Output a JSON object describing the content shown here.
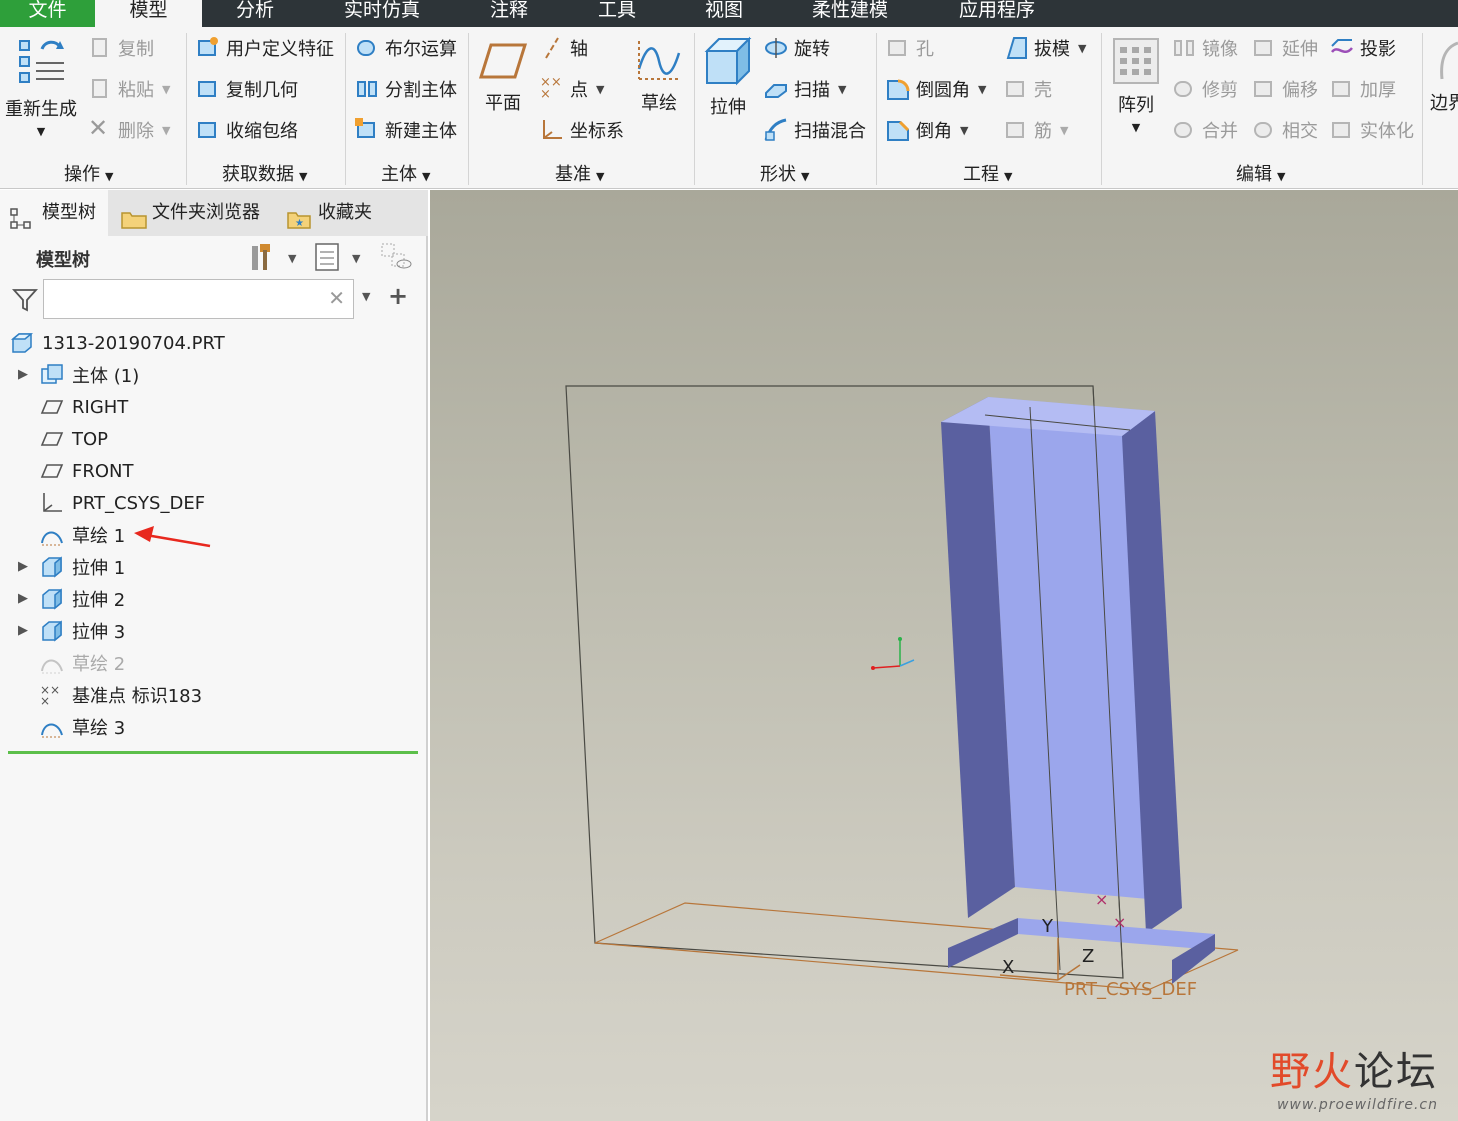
{
  "menu": {
    "tabs": [
      "文件",
      "模型",
      "分析",
      "实时仿真",
      "注释",
      "工具",
      "视图",
      "柔性建模",
      "应用程序"
    ],
    "active": "模型"
  },
  "ribbon": {
    "operations": {
      "regenerate": "重新生成",
      "copy": "复制",
      "paste": "粘贴",
      "delete": "删除",
      "label": "操作"
    },
    "get_data": {
      "udf": "用户定义特征",
      "copy_geometry": "复制几何",
      "shrinkwrap": "收缩包络",
      "label": "获取数据"
    },
    "body": {
      "boolean": "布尔运算",
      "split_body": "分割主体",
      "new_body": "新建主体",
      "label": "主体"
    },
    "datum": {
      "plane": "平面",
      "axis": "轴",
      "point": "点",
      "csys": "坐标系",
      "sketch": "草绘",
      "label": "基准"
    },
    "shapes": {
      "extrude": "拉伸",
      "revolve": "旋转",
      "sweep": "扫描",
      "swept_blend": "扫描混合",
      "label": "形状"
    },
    "engineering": {
      "hole": "孔",
      "draft": "拔模",
      "round": "倒圆角",
      "shell": "壳",
      "chamfer": "倒角",
      "rib": "筋",
      "label": "工程"
    },
    "editing": {
      "pattern": "阵列",
      "mirror": "镜像",
      "extend": "延伸",
      "project": "投影",
      "trim": "修剪",
      "offset": "偏移",
      "thicken": "加厚",
      "merge": "合并",
      "intersect": "相交",
      "solidify": "实体化",
      "label": "编辑"
    },
    "boundary": {
      "label": "边界"
    }
  },
  "panel": {
    "tabs": {
      "model_tree": "模型树",
      "folder_browser": "文件夹浏览器",
      "favorites": "收藏夹"
    },
    "tree_title": "模型树",
    "filter": {
      "value": "",
      "placeholder": ""
    },
    "tree": [
      {
        "label": "1313-20190704.PRT",
        "icon": "part-icon",
        "expandable": false,
        "dim": false
      },
      {
        "label": "主体 (1)",
        "icon": "body-icon",
        "expandable": true,
        "dim": false
      },
      {
        "label": "RIGHT",
        "icon": "datum-plane-icon",
        "expandable": false,
        "dim": false
      },
      {
        "label": "TOP",
        "icon": "datum-plane-icon",
        "expandable": false,
        "dim": false
      },
      {
        "label": "FRONT",
        "icon": "datum-plane-icon",
        "expandable": false,
        "dim": false
      },
      {
        "label": "PRT_CSYS_DEF",
        "icon": "csys-icon",
        "expandable": false,
        "dim": false
      },
      {
        "label": "草绘 1",
        "icon": "sketch-icon",
        "expandable": false,
        "dim": false
      },
      {
        "label": "拉伸 1",
        "icon": "extrude-icon",
        "expandable": true,
        "dim": false
      },
      {
        "label": "拉伸 2",
        "icon": "extrude-icon",
        "expandable": true,
        "dim": false
      },
      {
        "label": "拉伸 3",
        "icon": "extrude-icon",
        "expandable": true,
        "dim": false
      },
      {
        "label": "草绘 2",
        "icon": "sketch-icon",
        "expandable": false,
        "dim": true
      },
      {
        "label": "基准点 标识183",
        "icon": "datum-point-icon",
        "expandable": false,
        "dim": false
      },
      {
        "label": "草绘 3",
        "icon": "sketch-icon",
        "expandable": false,
        "dim": false
      }
    ]
  },
  "viewport": {
    "csys_label": "PRT_CSYS_DEF",
    "axis_x": "X",
    "axis_y": "Y",
    "axis_z": "Z"
  },
  "watermark": {
    "title_a": "野火",
    "title_b": "论坛",
    "url": "www.proewildfire.cn"
  },
  "colors": {
    "menubar": "#2d3438",
    "file_tab": "#2e9f3a",
    "accent_blue": "#2f7fc4",
    "surface_front": "#9ba6ec",
    "surface_side": "#5a60a0",
    "annotation_arrow": "#e8281e",
    "datum_orange": "#b8763a"
  }
}
